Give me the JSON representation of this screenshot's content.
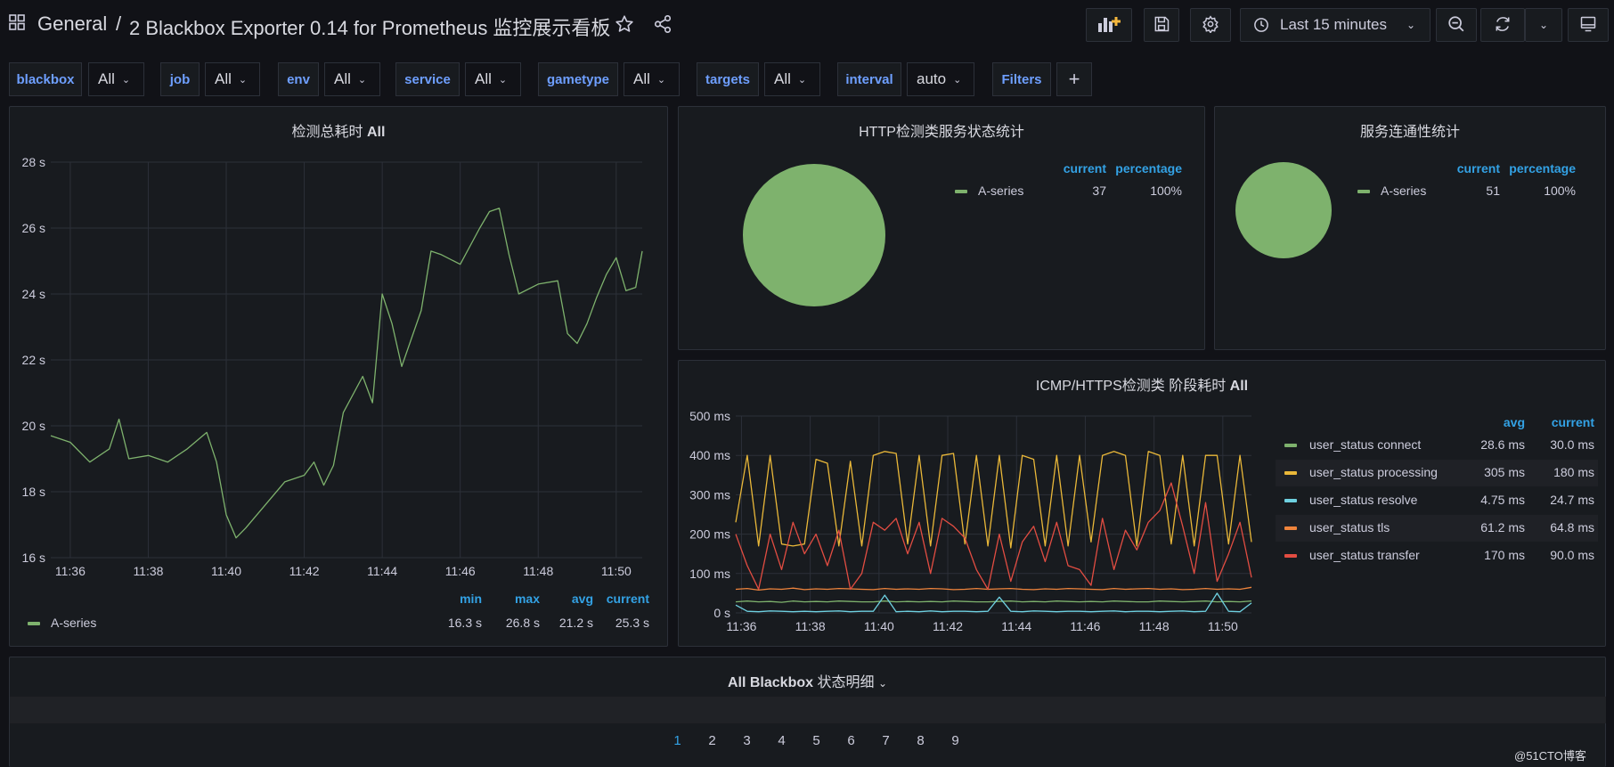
{
  "header": {
    "folder": "General",
    "sep": "/",
    "title": "2 Blackbox Exporter 0.14 for Prometheus 监控展示看板",
    "time_range": "Last 15 minutes"
  },
  "variables": [
    {
      "label": "blackbox",
      "value": "All"
    },
    {
      "label": "job",
      "value": "All"
    },
    {
      "label": "env",
      "value": "All"
    },
    {
      "label": "service",
      "value": "All"
    },
    {
      "label": "gametype",
      "value": "All"
    },
    {
      "label": "targets",
      "value": "All"
    },
    {
      "label": "interval",
      "value": "auto"
    },
    {
      "label": "Filters",
      "value": ""
    }
  ],
  "panels": {
    "total": {
      "title_prefix": "检测总耗时",
      "title_bold": "All",
      "legend_headers": [
        "min",
        "max",
        "avg",
        "current"
      ],
      "series_name": "A-series",
      "legend_values": [
        "16.3 s",
        "26.8 s",
        "21.2 s",
        "25.3 s"
      ],
      "y_ticks": [
        "28 s",
        "26 s",
        "24 s",
        "22 s",
        "20 s",
        "18 s",
        "16 s"
      ],
      "x_ticks": [
        "11:36",
        "11:38",
        "11:40",
        "11:42",
        "11:44",
        "11:46",
        "11:48",
        "11:50"
      ]
    },
    "http": {
      "title": "HTTP检测类服务状态统计",
      "legend_headers": [
        "current",
        "percentage"
      ],
      "series_name": "A-series",
      "current": "37",
      "percentage": "100%"
    },
    "conn": {
      "title": "服务连通性统计",
      "legend_headers": [
        "current",
        "percentage"
      ],
      "series_name": "A-series",
      "current": "51",
      "percentage": "100%"
    },
    "phase": {
      "title_prefix": "ICMP/HTTPS检测类 阶段耗时",
      "title_bold": "All",
      "legend_headers": [
        "avg",
        "current"
      ],
      "y_ticks": [
        "500 ms",
        "400 ms",
        "300 ms",
        "200 ms",
        "100 ms",
        "0 s"
      ],
      "x_ticks": [
        "11:36",
        "11:38",
        "11:40",
        "11:42",
        "11:44",
        "11:46",
        "11:48",
        "11:50"
      ],
      "series": [
        {
          "name": "user_status connect",
          "avg": "28.6 ms",
          "current": "30.0 ms",
          "color": "#7eb26d"
        },
        {
          "name": "user_status processing",
          "avg": "305 ms",
          "current": "180 ms",
          "color": "#eab839"
        },
        {
          "name": "user_status resolve",
          "avg": "4.75 ms",
          "current": "24.7 ms",
          "color": "#6ed0e0"
        },
        {
          "name": "user_status tls",
          "avg": "61.2 ms",
          "current": "64.8 ms",
          "color": "#ef843c"
        },
        {
          "name": "user_status transfer",
          "avg": "170 ms",
          "current": "90.0 ms",
          "color": "#e24d42"
        }
      ]
    },
    "table": {
      "title_prefix": "All Blackbox",
      "title_suffix": "状态明细",
      "pages": [
        "1",
        "2",
        "3",
        "4",
        "5",
        "6",
        "7",
        "8",
        "9"
      ]
    }
  },
  "watermark": "@51CTO博客",
  "colors": {
    "accent": "#33a2e5",
    "series_green": "#7eb26d",
    "background": "#111217",
    "panel": "#181b1f"
  },
  "chart_data": [
    {
      "type": "line",
      "title": "检测总耗时 All",
      "x": [
        "11:35:30",
        "11:36:00",
        "11:36:30",
        "11:37:00",
        "11:37:15",
        "11:37:30",
        "11:38:00",
        "11:38:30",
        "11:39:00",
        "11:39:30",
        "11:39:45",
        "11:40:00",
        "11:40:15",
        "11:40:30",
        "11:41:00",
        "11:41:30",
        "11:42:00",
        "11:42:15",
        "11:42:30",
        "11:42:45",
        "11:43:00",
        "11:43:30",
        "11:43:45",
        "11:44:00",
        "11:44:15",
        "11:44:30",
        "11:45:00",
        "11:45:15",
        "11:45:30",
        "11:46:00",
        "11:46:30",
        "11:46:45",
        "11:47:00",
        "11:47:15",
        "11:47:30",
        "11:48:00",
        "11:48:30",
        "11:48:45",
        "11:49:00",
        "11:49:15",
        "11:49:30",
        "11:49:45",
        "11:50:00",
        "11:50:15",
        "11:50:30",
        "11:50:40"
      ],
      "series": [
        {
          "name": "A-series",
          "values": [
            19.7,
            19.5,
            18.9,
            19.3,
            20.2,
            19.0,
            19.1,
            18.9,
            19.3,
            19.8,
            18.9,
            17.3,
            16.6,
            16.9,
            17.6,
            18.3,
            18.5,
            18.9,
            18.2,
            18.8,
            20.4,
            21.5,
            20.7,
            24.0,
            23.1,
            21.8,
            23.5,
            25.3,
            25.2,
            24.9,
            26.0,
            26.5,
            26.6,
            25.2,
            24.0,
            24.3,
            24.4,
            22.8,
            22.5,
            23.1,
            23.9,
            24.6,
            25.1,
            24.1,
            24.2,
            25.3
          ]
        }
      ],
      "ylim": [
        16,
        28
      ]
    },
    {
      "type": "pie",
      "title": "HTTP检测类服务状态统计",
      "categories": [
        "A-series"
      ],
      "values": [
        37
      ]
    },
    {
      "type": "pie",
      "title": "服务连通性统计",
      "categories": [
        "A-series"
      ],
      "values": [
        51
      ]
    },
    {
      "type": "line",
      "title": "ICMP/HTTPS检测类 阶段耗时 All",
      "ylim": [
        0,
        500
      ],
      "x": [
        "11:35:50",
        "11:36:10",
        "11:36:30",
        "11:36:50",
        "11:37:10",
        "11:37:30",
        "11:37:50",
        "11:38:10",
        "11:38:30",
        "11:38:50",
        "11:39:10",
        "11:39:30",
        "11:39:50",
        "11:40:10",
        "11:40:30",
        "11:40:50",
        "11:41:10",
        "11:41:30",
        "11:41:50",
        "11:42:10",
        "11:42:30",
        "11:42:50",
        "11:43:10",
        "11:43:30",
        "11:43:50",
        "11:44:10",
        "11:44:30",
        "11:44:50",
        "11:45:10",
        "11:45:30",
        "11:45:50",
        "11:46:10",
        "11:46:30",
        "11:46:50",
        "11:47:10",
        "11:47:30",
        "11:47:50",
        "11:48:10",
        "11:48:30",
        "11:48:50",
        "11:49:10",
        "11:49:30",
        "11:49:50",
        "11:50:10",
        "11:50:30",
        "11:50:50"
      ],
      "series": [
        {
          "name": "user_status connect",
          "values": [
            28,
            30,
            28,
            29,
            27,
            30,
            28,
            29,
            28,
            30,
            29,
            28,
            28,
            30,
            28,
            29,
            28,
            29,
            28,
            30,
            29,
            28,
            28,
            29,
            30,
            28,
            29,
            28,
            30,
            29,
            28,
            29,
            28,
            30,
            29,
            28,
            28,
            30,
            29,
            28,
            29,
            30,
            28,
            29,
            28,
            30
          ]
        },
        {
          "name": "user_status processing",
          "values": [
            230,
            400,
            170,
            400,
            175,
            170,
            175,
            390,
            380,
            170,
            385,
            170,
            400,
            410,
            405,
            175,
            400,
            170,
            400,
            405,
            175,
            400,
            170,
            400,
            165,
            400,
            390,
            170,
            400,
            170,
            400,
            180,
            400,
            410,
            400,
            170,
            410,
            400,
            175,
            400,
            170,
            400,
            400,
            175,
            400,
            180
          ]
        },
        {
          "name": "user_status resolve",
          "values": [
            20,
            4,
            3,
            5,
            4,
            3,
            4,
            3,
            4,
            5,
            3,
            4,
            4,
            45,
            3,
            4,
            3,
            5,
            3,
            4,
            4,
            3,
            4,
            40,
            4,
            3,
            5,
            4,
            3,
            4,
            4,
            3,
            4,
            5,
            3,
            4,
            4,
            3,
            4,
            5,
            3,
            4,
            50,
            4,
            3,
            25
          ]
        },
        {
          "name": "user_status tls",
          "values": [
            60,
            62,
            58,
            61,
            60,
            63,
            59,
            61,
            60,
            62,
            61,
            60,
            59,
            62,
            60,
            61,
            60,
            62,
            61,
            59,
            60,
            62,
            60,
            61,
            62,
            60,
            59,
            61,
            60,
            62,
            61,
            60,
            59,
            62,
            60,
            61,
            62,
            60,
            61,
            59,
            60,
            62,
            60,
            61,
            60,
            65
          ]
        },
        {
          "name": "user_status transfer",
          "values": [
            200,
            120,
            60,
            200,
            110,
            230,
            150,
            200,
            120,
            210,
            60,
            100,
            230,
            210,
            240,
            150,
            230,
            100,
            240,
            220,
            190,
            110,
            60,
            200,
            80,
            180,
            220,
            130,
            230,
            120,
            110,
            70,
            240,
            110,
            210,
            160,
            230,
            260,
            330,
            220,
            100,
            280,
            80,
            150,
            230,
            90
          ]
        }
      ]
    }
  ]
}
